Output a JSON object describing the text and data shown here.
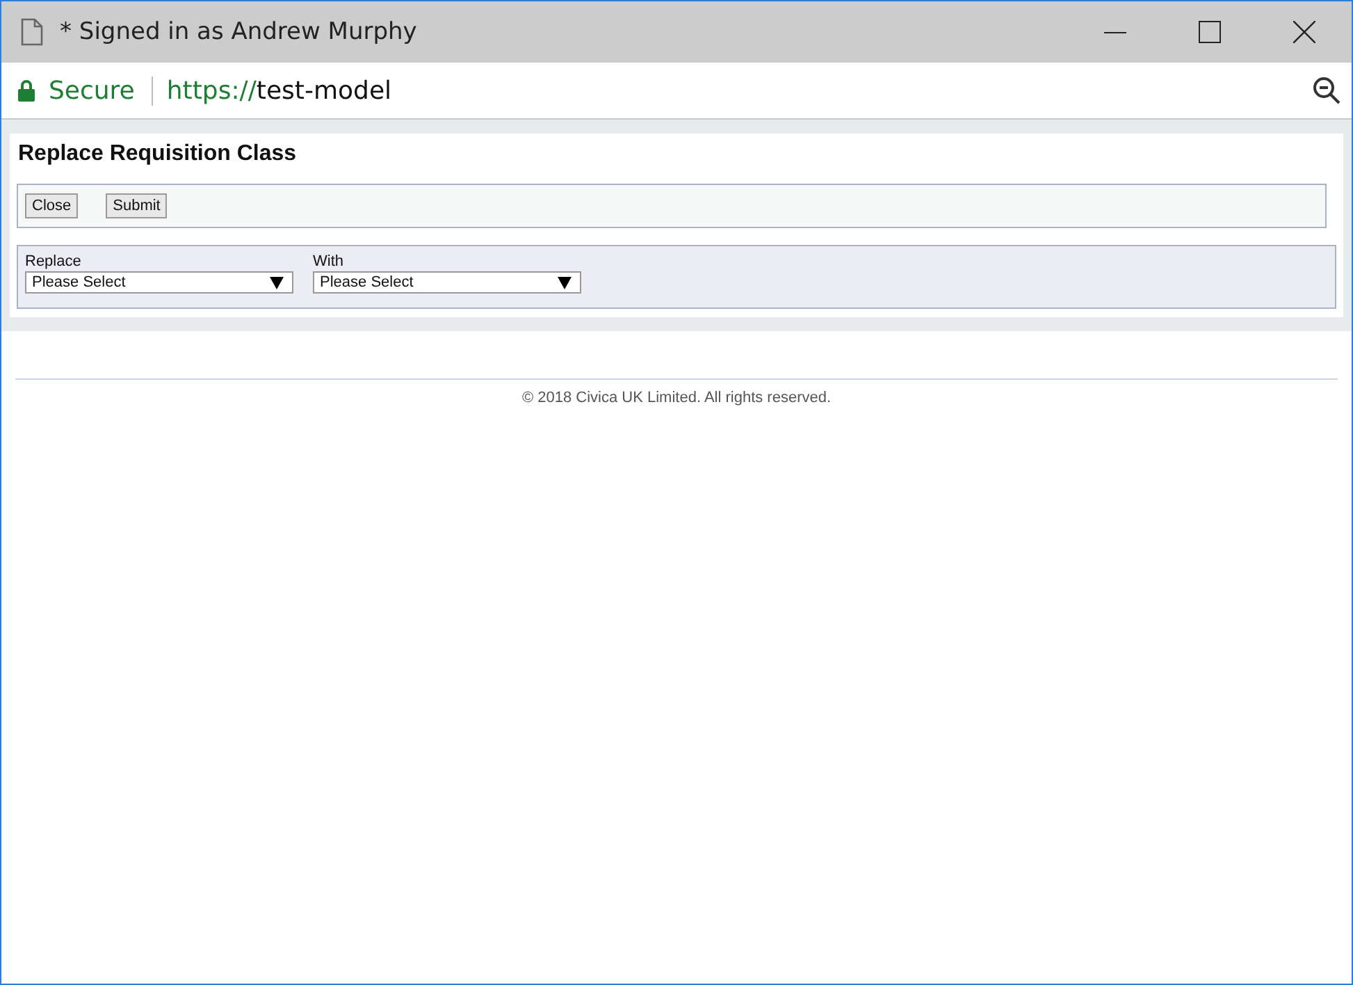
{
  "window": {
    "title": "* Signed in as Andrew Murphy"
  },
  "address_bar": {
    "security": "Secure",
    "scheme": "https://",
    "host": "test-model"
  },
  "page": {
    "heading": "Replace Requisition Class",
    "buttons": [
      "Close",
      "Submit"
    ],
    "fields": [
      {
        "label": "Replace",
        "value": "Please Select"
      },
      {
        "label": "With",
        "value": "Please Select"
      }
    ]
  },
  "footer": "© 2018 Civica UK Limited. All rights reserved."
}
